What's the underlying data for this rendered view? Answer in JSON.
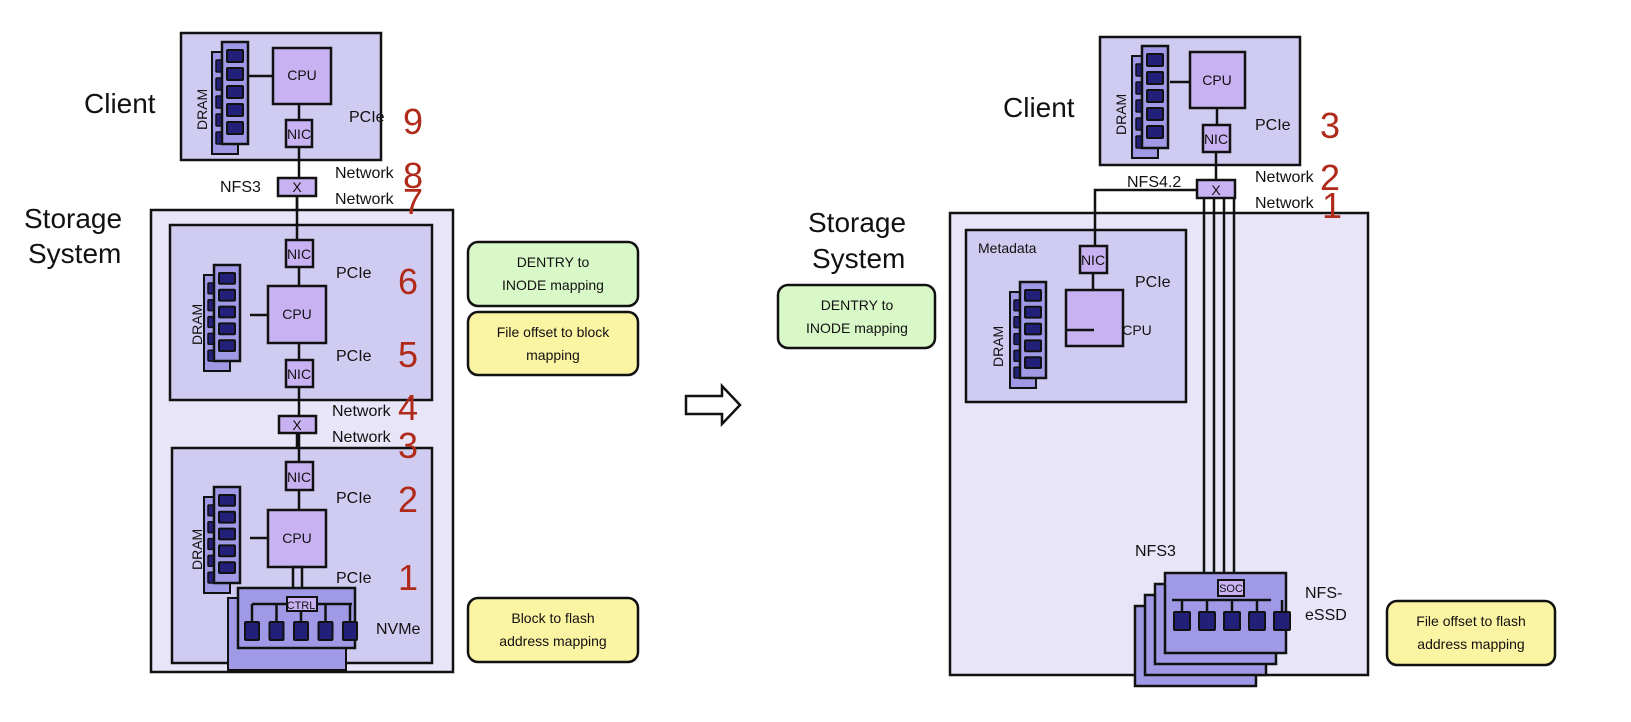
{
  "colors": {
    "outer": "#e7e5f7",
    "inner": "#d0ccf1",
    "cpu": "#c8b2f2",
    "module": "#a09ae6",
    "chip": "#23207a",
    "number": "#b02a1a",
    "green": "#d9f8c8",
    "yellow": "#fbf4a2"
  },
  "left": {
    "client": "Client",
    "storage_line1": "Storage",
    "storage_line2": "System",
    "client_node": {
      "dram": "DRAM",
      "cpu": "CPU",
      "nic": "NIC",
      "pcie": "PCIe",
      "num": "9"
    },
    "switch": {
      "x": "X",
      "protocol": "NFS3",
      "net_top": "Network",
      "net_top_num": "8",
      "net_bottom": "Network",
      "net_bottom_num": "7"
    },
    "server_node": {
      "dram": "DRAM",
      "cpu": "CPU",
      "nic_top": "NIC",
      "nic_bottom": "NIC",
      "pcie_top": "PCIe",
      "pcie_top_num": "6",
      "pcie_bottom": "PCIe",
      "pcie_bottom_num": "5"
    },
    "switch2": {
      "x": "X",
      "net_top": "Network",
      "net_top_num": "4",
      "net_bottom": "Network",
      "net_bottom_num": "3"
    },
    "storage_node": {
      "dram": "DRAM",
      "cpu": "CPU",
      "nic": "NIC",
      "pcie_top": "PCIe",
      "pcie_top_num": "2",
      "pcie_bottom": "PCIe",
      "pcie_bottom_num": "1",
      "ctrl": "CTRL",
      "nvme": "NVMe"
    },
    "notes": [
      {
        "line1": "DENTRY to",
        "line2": "INODE mapping",
        "color": "green"
      },
      {
        "line1": "File offset to block",
        "line2": "mapping",
        "color": "yellow"
      },
      {
        "line1": "Block to flash",
        "line2": "address mapping",
        "color": "yellow"
      }
    ]
  },
  "arrow_icon": "hollow-right-arrow",
  "right": {
    "client": "Client",
    "storage_line1": "Storage",
    "storage_line2": "System",
    "client_node": {
      "dram": "DRAM",
      "cpu": "CPU",
      "nic": "NIC",
      "pcie": "PCIe",
      "num": "3"
    },
    "switch": {
      "x": "X",
      "protocol": "NFS4.2",
      "net_top": "Network",
      "net_top_num": "2",
      "net_bottom": "Network",
      "net_bottom_num": "1"
    },
    "metadata_node": {
      "title": "Metadata",
      "dram": "DRAM",
      "cpu": "CPU",
      "nic": "NIC",
      "pcie": "PCIe"
    },
    "essd": {
      "protocol": "NFS3",
      "soc": "SOC",
      "label_line1": "NFS-",
      "label_line2": "eSSD"
    },
    "notes": [
      {
        "line1": "DENTRY to",
        "line2": "INODE mapping",
        "color": "green"
      },
      {
        "line1": "File offset to flash",
        "line2": "address mapping",
        "color": "yellow"
      }
    ]
  }
}
